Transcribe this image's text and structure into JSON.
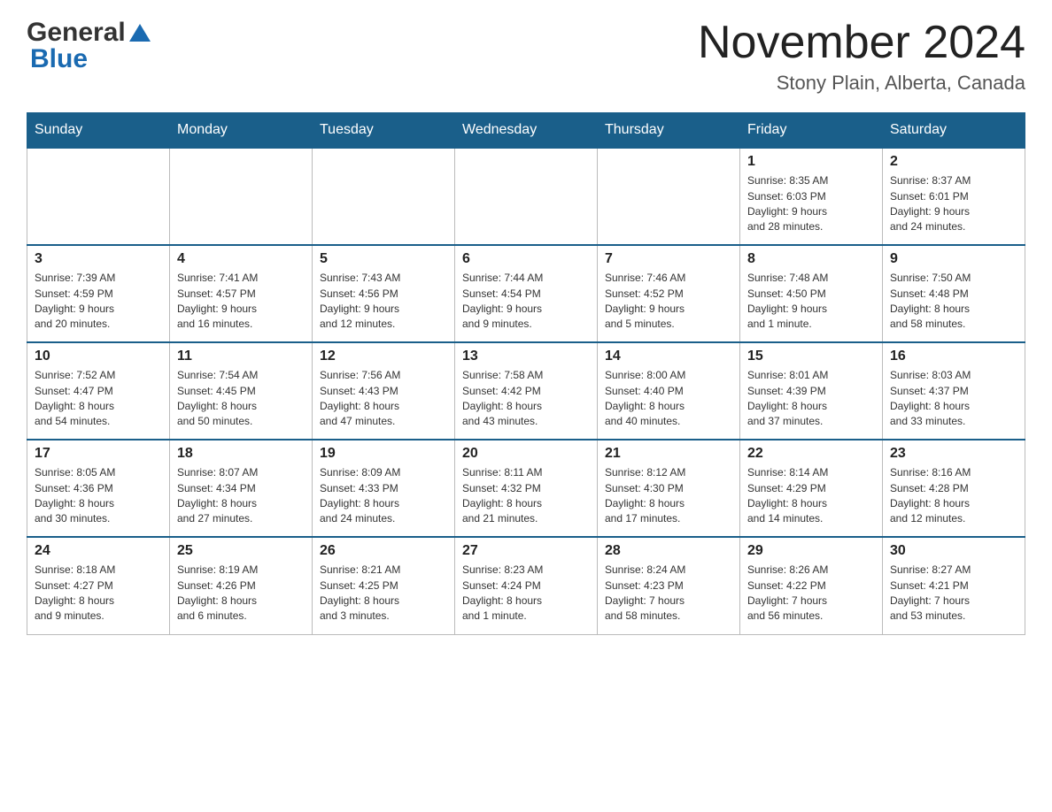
{
  "header": {
    "logo_general": "General",
    "logo_blue": "Blue",
    "month_title": "November 2024",
    "location": "Stony Plain, Alberta, Canada"
  },
  "days_of_week": [
    "Sunday",
    "Monday",
    "Tuesday",
    "Wednesday",
    "Thursday",
    "Friday",
    "Saturday"
  ],
  "weeks": [
    {
      "days": [
        {
          "number": "",
          "info": "",
          "empty": true
        },
        {
          "number": "",
          "info": "",
          "empty": true
        },
        {
          "number": "",
          "info": "",
          "empty": true
        },
        {
          "number": "",
          "info": "",
          "empty": true
        },
        {
          "number": "",
          "info": "",
          "empty": true
        },
        {
          "number": "1",
          "info": "Sunrise: 8:35 AM\nSunset: 6:03 PM\nDaylight: 9 hours\nand 28 minutes."
        },
        {
          "number": "2",
          "info": "Sunrise: 8:37 AM\nSunset: 6:01 PM\nDaylight: 9 hours\nand 24 minutes."
        }
      ]
    },
    {
      "days": [
        {
          "number": "3",
          "info": "Sunrise: 7:39 AM\nSunset: 4:59 PM\nDaylight: 9 hours\nand 20 minutes."
        },
        {
          "number": "4",
          "info": "Sunrise: 7:41 AM\nSunset: 4:57 PM\nDaylight: 9 hours\nand 16 minutes."
        },
        {
          "number": "5",
          "info": "Sunrise: 7:43 AM\nSunset: 4:56 PM\nDaylight: 9 hours\nand 12 minutes."
        },
        {
          "number": "6",
          "info": "Sunrise: 7:44 AM\nSunset: 4:54 PM\nDaylight: 9 hours\nand 9 minutes."
        },
        {
          "number": "7",
          "info": "Sunrise: 7:46 AM\nSunset: 4:52 PM\nDaylight: 9 hours\nand 5 minutes."
        },
        {
          "number": "8",
          "info": "Sunrise: 7:48 AM\nSunset: 4:50 PM\nDaylight: 9 hours\nand 1 minute."
        },
        {
          "number": "9",
          "info": "Sunrise: 7:50 AM\nSunset: 4:48 PM\nDaylight: 8 hours\nand 58 minutes."
        }
      ]
    },
    {
      "days": [
        {
          "number": "10",
          "info": "Sunrise: 7:52 AM\nSunset: 4:47 PM\nDaylight: 8 hours\nand 54 minutes."
        },
        {
          "number": "11",
          "info": "Sunrise: 7:54 AM\nSunset: 4:45 PM\nDaylight: 8 hours\nand 50 minutes."
        },
        {
          "number": "12",
          "info": "Sunrise: 7:56 AM\nSunset: 4:43 PM\nDaylight: 8 hours\nand 47 minutes."
        },
        {
          "number": "13",
          "info": "Sunrise: 7:58 AM\nSunset: 4:42 PM\nDaylight: 8 hours\nand 43 minutes."
        },
        {
          "number": "14",
          "info": "Sunrise: 8:00 AM\nSunset: 4:40 PM\nDaylight: 8 hours\nand 40 minutes."
        },
        {
          "number": "15",
          "info": "Sunrise: 8:01 AM\nSunset: 4:39 PM\nDaylight: 8 hours\nand 37 minutes."
        },
        {
          "number": "16",
          "info": "Sunrise: 8:03 AM\nSunset: 4:37 PM\nDaylight: 8 hours\nand 33 minutes."
        }
      ]
    },
    {
      "days": [
        {
          "number": "17",
          "info": "Sunrise: 8:05 AM\nSunset: 4:36 PM\nDaylight: 8 hours\nand 30 minutes."
        },
        {
          "number": "18",
          "info": "Sunrise: 8:07 AM\nSunset: 4:34 PM\nDaylight: 8 hours\nand 27 minutes."
        },
        {
          "number": "19",
          "info": "Sunrise: 8:09 AM\nSunset: 4:33 PM\nDaylight: 8 hours\nand 24 minutes."
        },
        {
          "number": "20",
          "info": "Sunrise: 8:11 AM\nSunset: 4:32 PM\nDaylight: 8 hours\nand 21 minutes."
        },
        {
          "number": "21",
          "info": "Sunrise: 8:12 AM\nSunset: 4:30 PM\nDaylight: 8 hours\nand 17 minutes."
        },
        {
          "number": "22",
          "info": "Sunrise: 8:14 AM\nSunset: 4:29 PM\nDaylight: 8 hours\nand 14 minutes."
        },
        {
          "number": "23",
          "info": "Sunrise: 8:16 AM\nSunset: 4:28 PM\nDaylight: 8 hours\nand 12 minutes."
        }
      ]
    },
    {
      "days": [
        {
          "number": "24",
          "info": "Sunrise: 8:18 AM\nSunset: 4:27 PM\nDaylight: 8 hours\nand 9 minutes."
        },
        {
          "number": "25",
          "info": "Sunrise: 8:19 AM\nSunset: 4:26 PM\nDaylight: 8 hours\nand 6 minutes."
        },
        {
          "number": "26",
          "info": "Sunrise: 8:21 AM\nSunset: 4:25 PM\nDaylight: 8 hours\nand 3 minutes."
        },
        {
          "number": "27",
          "info": "Sunrise: 8:23 AM\nSunset: 4:24 PM\nDaylight: 8 hours\nand 1 minute."
        },
        {
          "number": "28",
          "info": "Sunrise: 8:24 AM\nSunset: 4:23 PM\nDaylight: 7 hours\nand 58 minutes."
        },
        {
          "number": "29",
          "info": "Sunrise: 8:26 AM\nSunset: 4:22 PM\nDaylight: 7 hours\nand 56 minutes."
        },
        {
          "number": "30",
          "info": "Sunrise: 8:27 AM\nSunset: 4:21 PM\nDaylight: 7 hours\nand 53 minutes."
        }
      ]
    }
  ]
}
